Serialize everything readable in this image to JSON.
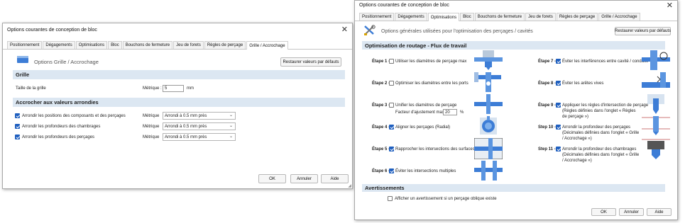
{
  "dlg1": {
    "title": "Options courantes de conception de bloc",
    "tabs": [
      "Positionnement",
      "Dégagements",
      "Optimisations",
      "Bloc",
      "Bouchons de fermeture",
      "Jeu de forets",
      "Règles de perçage",
      "Grille / Accrochage"
    ],
    "header_label": "Options Grille / Accrochage",
    "restore": "Restaurer valeurs par défauts",
    "grille_title": "Grille",
    "grid_size_label": "Taille de la grille",
    "metrique_label": "Métrique :",
    "grid_size_value": "5",
    "grid_unit": "mm",
    "snap_title": "Accrocher aux valeurs arrondies",
    "snap_rows": [
      {
        "label": "Arrondir les positions des composants et des perçages",
        "metric": "Métrique",
        "value": "Arrondi à 0.5 mm près"
      },
      {
        "label": "Arrondir les profondeurs des chambrages",
        "metric": "Métrique",
        "value": "Arrondi à 0.5 mm près"
      },
      {
        "label": "Arrondir les profondeurs des perçages",
        "metric": "Métrique",
        "value": "Arrondi à 0.5 mm près"
      }
    ],
    "ok": "OK",
    "cancel": "Annuler",
    "help": "Aide"
  },
  "dlg2": {
    "title": "Options courantes de conception de bloc",
    "tabs": [
      "Positionnement",
      "Dégagements",
      "Optimisations",
      "Bloc",
      "Bouchons de fermeture",
      "Jeu de forets",
      "Règles de perçage",
      "Grille / Accrochage"
    ],
    "header_label": "Options générales utilisées pour l'optimisation des perçages / cavités",
    "restore": "Restaurer valeurs par défauts",
    "flow_title": "Optimisation de routage - Flux de travail",
    "steps_left": [
      {
        "step": "Étape 1 -",
        "label": "Utiliser les diamètres de perçage max",
        "checked": false
      },
      {
        "step": "Étape 2 -",
        "label": "Optimiser les diamètres entre les ports",
        "checked": false
      },
      {
        "step": "Étape 3 -",
        "label": "Unifier les diamètres de perçage",
        "checked": false
      },
      {
        "step": "Étape 4 -",
        "label": "Aligner les perçages (Radial)",
        "checked": true
      },
      {
        "step": "Étape 5 -",
        "label": "Rapprocher les intersections des surfaces",
        "checked": true
      },
      {
        "step": "Étape 6 -",
        "label": "Éviter les intersections multiples",
        "checked": true
      }
    ],
    "factor_label": "Facteur d'ajustement max :",
    "factor_value": "20",
    "factor_unit": "%",
    "steps_right": [
      {
        "step": "Étape 7 -",
        "label": "Éviter les interférences entre cavité / conduite",
        "sub": "",
        "checked": true
      },
      {
        "step": "Étape 8 -",
        "label": "Éviter les arêtes vives",
        "sub": "",
        "checked": true
      },
      {
        "step": "Étape 9 -",
        "label": "Appliquer les règles d'intersection de perçage",
        "sub": "(Règles définies dans l'onglet « Règles de perçage »)",
        "checked": true
      },
      {
        "step": "Step 10 -",
        "label": "Arrondir la profondeur des perçages",
        "sub": "(Décimales définies dans l'onglet « Grille / Accrochage »)",
        "checked": true
      },
      {
        "step": "Step 11 -",
        "label": "Arrondir la profondeur des chambrages",
        "sub": "(Décimales définies dans l'onglet « Grille / Accrochage »)",
        "checked": true
      }
    ],
    "warn_title": "Avertissements",
    "warn_label": "Afficher un avertissement si un perçage oblique existe",
    "ok": "OK",
    "cancel": "Annuler",
    "help": "Aide"
  },
  "colors": {
    "section_bg": "#dce7f2",
    "checkbox": "#1f5fbf",
    "pipe": "#3d7dd6"
  }
}
